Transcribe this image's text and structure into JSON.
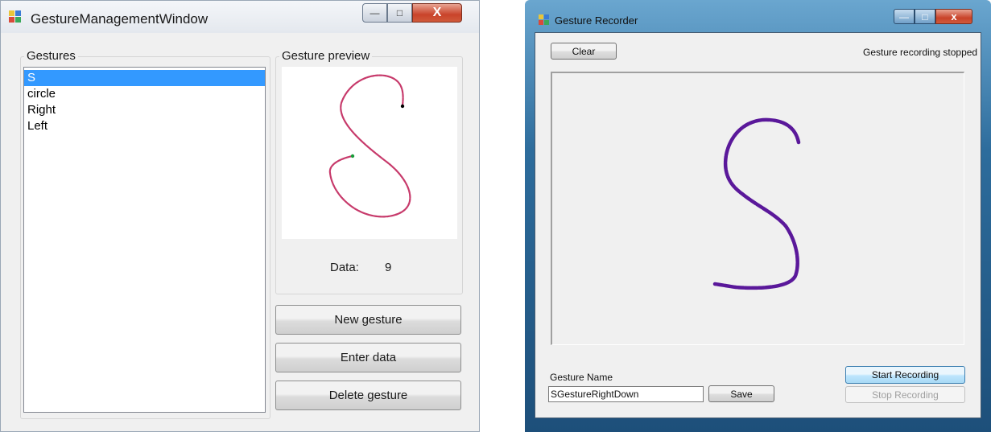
{
  "window1": {
    "title": "GestureManagementWindow",
    "gestures_group_label": "Gestures",
    "gestures": [
      {
        "label": "S",
        "selected": true
      },
      {
        "label": "circle",
        "selected": false
      },
      {
        "label": "Right",
        "selected": false
      },
      {
        "label": "Left",
        "selected": false
      }
    ],
    "preview_group_label": "Gesture preview",
    "data_label": "Data:",
    "data_value": "9",
    "buttons": {
      "new_gesture": "New gesture",
      "enter_data": "Enter data",
      "delete_gesture": "Delete gesture"
    },
    "caption_buttons": {
      "minimize": "—",
      "maximize": "□",
      "close": "X"
    },
    "colors": {
      "selection": "#3399ff",
      "stroke": "#c73a6b",
      "start_point": "#1a9a3a",
      "end_point": "#000000"
    }
  },
  "window2": {
    "title": "Gesture Recorder",
    "clear_label": "Clear",
    "status_text": "Gesture recording stopped",
    "gesture_name_label": "Gesture Name",
    "gesture_name_value": "SGestureRightDown",
    "save_label": "Save",
    "start_recording_label": "Start Recording",
    "stop_recording_label": "Stop Recording",
    "caption_buttons": {
      "minimize": "—",
      "maximize": "□",
      "close": "x"
    },
    "colors": {
      "stroke": "#5a189a",
      "frame": "#2d6c9c"
    }
  }
}
